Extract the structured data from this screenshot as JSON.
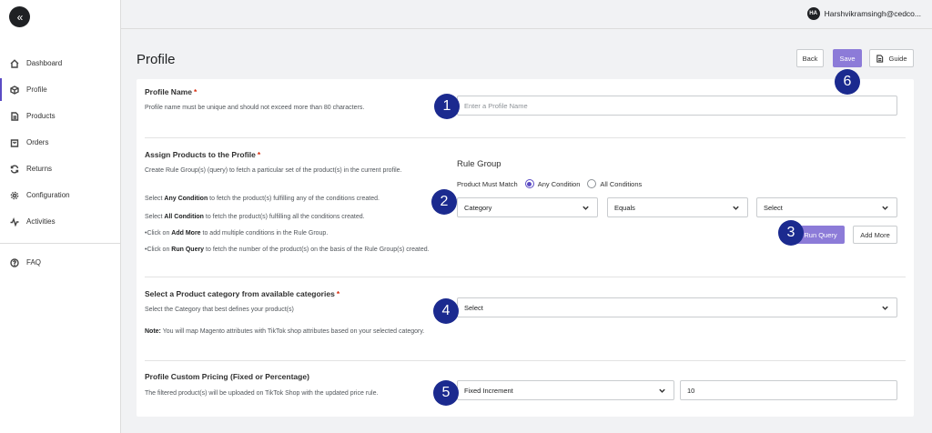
{
  "topbar": {
    "user_initials": "HA",
    "user_name": "Harshvikramsingh@cedco..."
  },
  "sidebar": {
    "collapse_icon": "«",
    "items": [
      {
        "label": "Dashboard",
        "icon": "home-icon"
      },
      {
        "label": "Profile",
        "icon": "cube-icon",
        "active": true
      },
      {
        "label": "Products",
        "icon": "document-icon"
      },
      {
        "label": "Orders",
        "icon": "bag-icon"
      },
      {
        "label": "Returns",
        "icon": "refresh-icon"
      },
      {
        "label": "Configuration",
        "icon": "gear-icon"
      },
      {
        "label": "Activities",
        "icon": "pulse-icon"
      }
    ],
    "faq": {
      "label": "FAQ",
      "icon": "question-icon"
    }
  },
  "page": {
    "title": "Profile",
    "back_label": "Back",
    "save_label": "Save",
    "guide_label": "Guide"
  },
  "profile_name": {
    "title": "Profile Name",
    "required_mark": "*",
    "description": "Profile name must be unique and should not exceed more than 80 characters.",
    "placeholder": "Enter a Profile Name",
    "value": ""
  },
  "assign": {
    "title": "Assign Products to the Profile",
    "required_mark": "*",
    "desc1": "Create Rule Group(s) (query) to fetch a particular set of the product(s) in the current profile.",
    "desc2_pre": "Select ",
    "desc2_bold": "Any Condition",
    "desc2_post": "  to fetch the product(s) fulfilling any of the conditions created.",
    "desc3_pre": "Select ",
    "desc3_bold": "All Condition",
    "desc3_post": " to fetch the product(s) fulfilling all the conditions created.",
    "desc4_pre": "•Click on ",
    "desc4_bold": "Add More",
    "desc4_post": " to add multiple conditions in the Rule Group.",
    "desc5_pre": "•Click on ",
    "desc5_bold": "Run Query",
    "desc5_post": " to fetch the number of the product(s) on the basis of the Rule Group(s) created.",
    "rule_group_title": "Rule Group",
    "must_match_label": "Product Must Match",
    "any_condition": "Any Condition",
    "all_conditions": "All Conditions",
    "selected_match": "Any Condition",
    "attribute_value": "Category",
    "operator_value": "Equals",
    "value_select": "Select",
    "run_query_label": "Run Query",
    "add_more_label": "Add More"
  },
  "category": {
    "title": "Select a Product category from available categories",
    "required_mark": "*",
    "description": "Select the Category that best defines your product(s)",
    "note_label": "Note:",
    "note_text": " You will map Magento attributes with TikTok shop attributes based on your selected category.",
    "select_value": "Select"
  },
  "pricing": {
    "title": "Profile Custom Pricing (Fixed or Percentage)",
    "description": "The filtered product(s) will be uploaded on TikTok Shop with the updated price rule.",
    "type_value": "Fixed Increment",
    "amount_value": "10"
  },
  "badges": [
    "1",
    "2",
    "3",
    "4",
    "5",
    "6"
  ],
  "colors": {
    "accent": "#8c7bd8",
    "badge": "#1b2a8f",
    "required": "#d72c0d"
  }
}
